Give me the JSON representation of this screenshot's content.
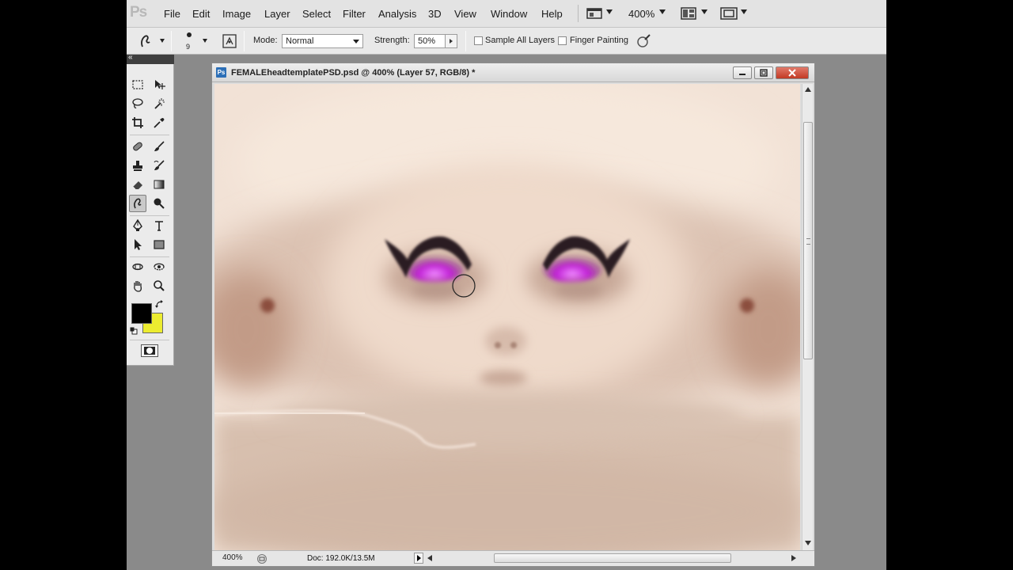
{
  "app": {
    "logo": "Ps"
  },
  "menu": {
    "items": [
      "File",
      "Edit",
      "Image",
      "Layer",
      "Select",
      "Filter",
      "Analysis",
      "3D",
      "View",
      "Window",
      "Help"
    ],
    "zoom_display": "400%"
  },
  "options": {
    "brush_size": "9",
    "mode_label": "Mode:",
    "mode_value": "Normal",
    "strength_label": "Strength:",
    "strength_value": "50%",
    "sample_all_layers": "Sample All Layers",
    "finger_painting": "Finger Painting"
  },
  "document": {
    "icon_text": "Ps",
    "title": "FEMALEheadtemplatePSD.psd @ 400% (Layer 57, RGB/8) *",
    "status_zoom": "400%",
    "status_doc": "Doc: 192.0K/13.5M"
  },
  "colors": {
    "foreground": "#000000",
    "background": "#ecec30",
    "skin": "#f2e2d6",
    "eyeshadow": "#c11fd6"
  },
  "icons": {
    "smudge_tool": "smudge-icon",
    "brush_preset": "brush-preset-icon",
    "tablet_pressure": "tablet-pressure-icon"
  }
}
